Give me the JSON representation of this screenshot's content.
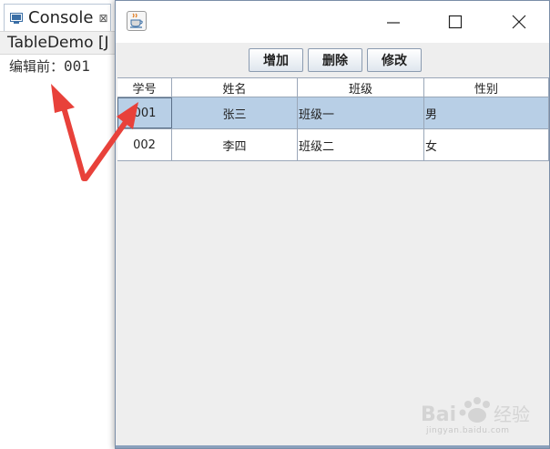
{
  "console": {
    "tab_title": "Console",
    "tab_close": "⊠",
    "header_text": "TableDemo [J",
    "output_label": "编辑前：",
    "output_value": "001"
  },
  "window": {
    "icon": "java-cup-icon",
    "minimize": "—",
    "maximize": "☐",
    "close": "✕"
  },
  "toolbar": {
    "add_label": "增加",
    "delete_label": "删除",
    "edit_label": "修改"
  },
  "table": {
    "columns": [
      "学号",
      "姓名",
      "班级",
      "性别"
    ],
    "rows": [
      [
        "001",
        "张三",
        "班级一",
        "男"
      ],
      [
        "002",
        "李四",
        "班级二",
        "女"
      ]
    ],
    "selected_row": 0
  },
  "watermark": {
    "brand": "Bai",
    "brand_cn": "经验",
    "url": "jingyan.baidu.com"
  },
  "colors": {
    "arrow": "#e8413a",
    "selected_row": "#b8cfe6"
  }
}
